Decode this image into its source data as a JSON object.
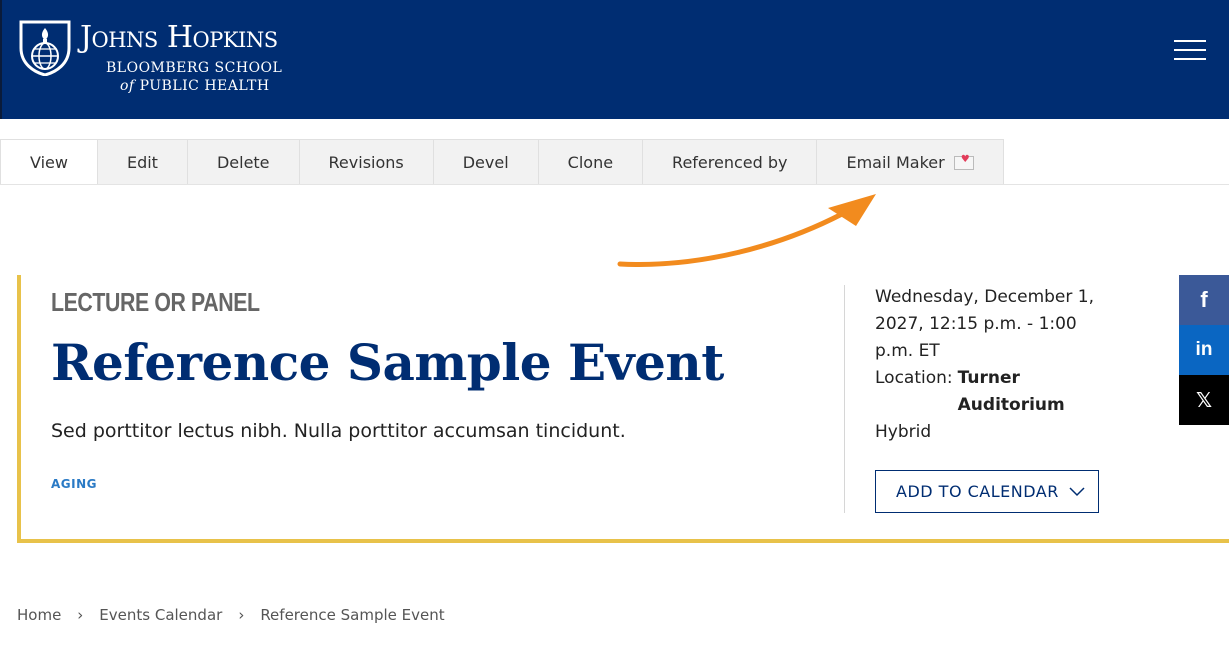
{
  "header": {
    "logo_title": "Johns Hopkins",
    "logo_sub1": "BLOOMBERG SCHOOL",
    "logo_sub2_of": "of",
    "logo_sub2": "PUBLIC HEALTH",
    "background": "#002d72",
    "menu_icon": "hamburger-icon"
  },
  "tabs": [
    {
      "label": "View",
      "active": true
    },
    {
      "label": "Edit"
    },
    {
      "label": "Delete"
    },
    {
      "label": "Revisions"
    },
    {
      "label": "Devel"
    },
    {
      "label": "Clone"
    },
    {
      "label": "Referenced by"
    },
    {
      "label": "Email Maker"
    }
  ],
  "event": {
    "type": "LECTURE OR PANEL",
    "title": "Reference Sample Event",
    "description": "Sed porttitor lectus nibh. Nulla porttitor accumsan tincidunt.",
    "tag": "AGING",
    "datetime": "Wednesday, December 1, 2027, 12:15 p.m. - 1:00 p.m. ET",
    "location_label": "Location:",
    "location_value": "Turner Auditorium",
    "format": "Hybrid",
    "add_to_calendar": "ADD TO CALENDAR",
    "accent_color": "#e8c24a",
    "title_color": "#002d72"
  },
  "social": [
    {
      "icon": "facebook-icon",
      "glyph": "f"
    },
    {
      "icon": "linkedin-icon",
      "glyph": "in"
    },
    {
      "icon": "x-icon",
      "glyph": "𝕏"
    }
  ],
  "breadcrumb": {
    "items": [
      "Home",
      "Events Calendar",
      "Reference Sample Event"
    ],
    "separator": "›"
  }
}
